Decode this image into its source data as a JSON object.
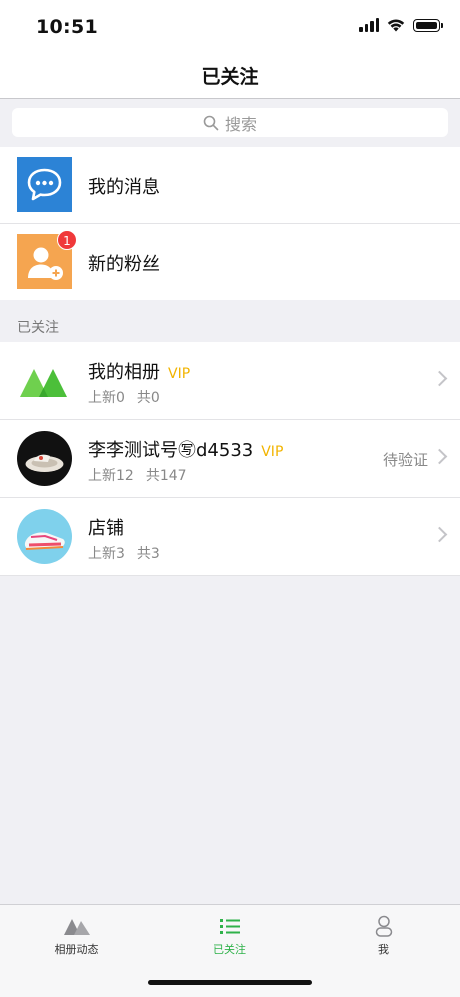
{
  "status_bar": {
    "time": "10:51"
  },
  "nav": {
    "title": "已关注"
  },
  "search": {
    "placeholder": "搜索"
  },
  "menu": [
    {
      "label": "我的消息",
      "icon": "chat-icon",
      "color": "#2c83d6"
    },
    {
      "label": "新的粉丝",
      "icon": "add-user-icon",
      "color": "#f5a550",
      "badge": "1"
    }
  ],
  "section": {
    "title": "已关注"
  },
  "follows": [
    {
      "name": "我的相册",
      "vip": "VIP",
      "new": "上新0",
      "total": "共0",
      "status": ""
    },
    {
      "name": "李李测试号㊢d4533",
      "vip": "VIP",
      "new": "上新12",
      "total": "共147",
      "status": "待验证"
    },
    {
      "name": "店铺",
      "vip": "",
      "new": "上新3",
      "total": "共3",
      "status": ""
    }
  ],
  "tabs": [
    {
      "label": "相册动态",
      "icon": "mountain-icon"
    },
    {
      "label": "已关注",
      "icon": "list-icon",
      "active": true
    },
    {
      "label": "我",
      "icon": "person-icon"
    }
  ],
  "colors": {
    "accent": "#2fb24a",
    "vip": "#f2b400",
    "badge": "#f0393a"
  }
}
